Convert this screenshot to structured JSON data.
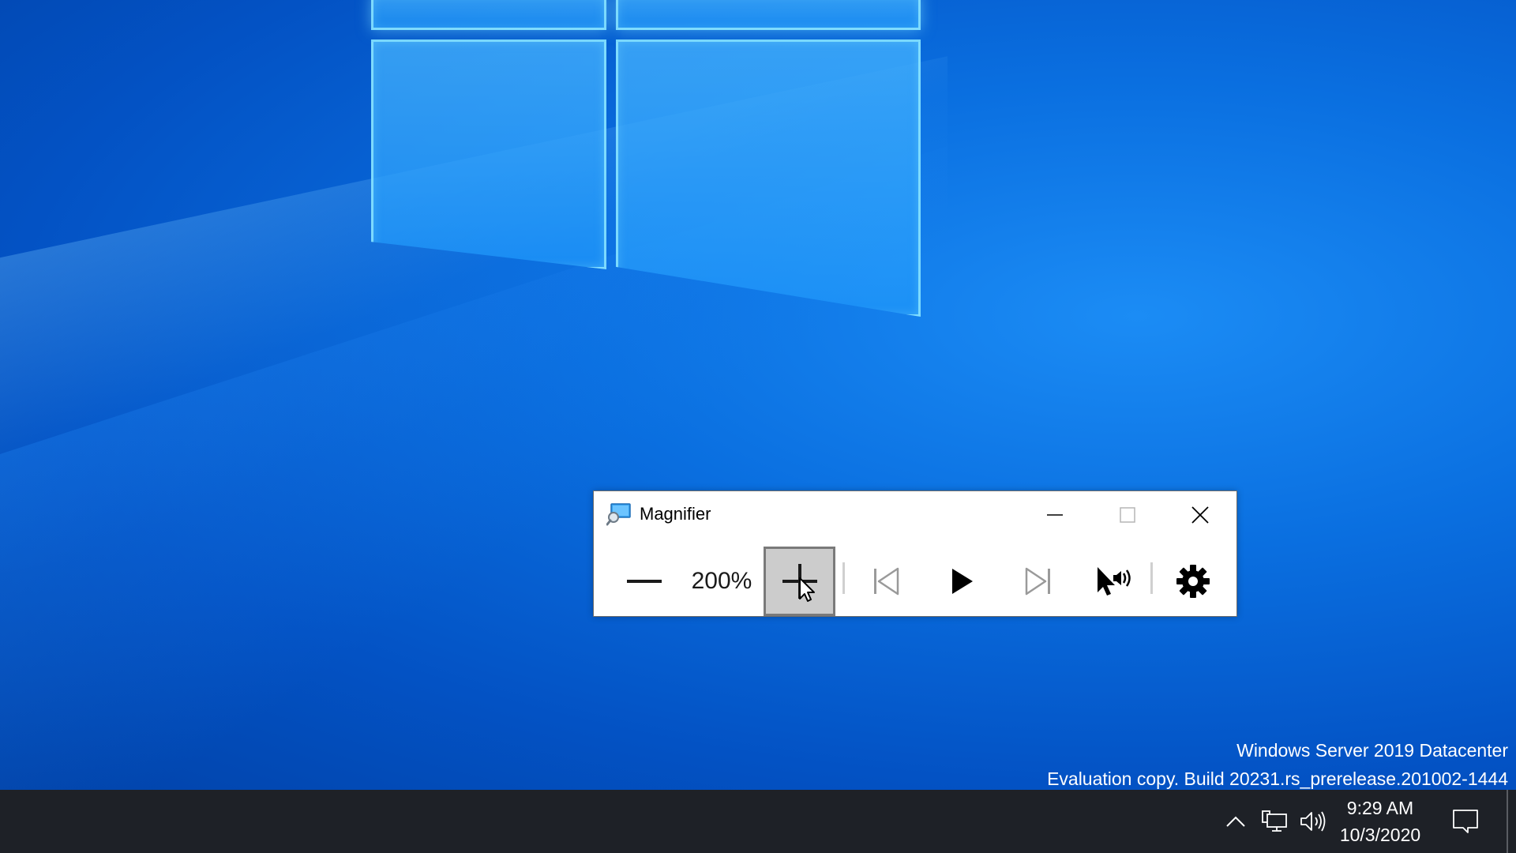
{
  "window": {
    "title": "Magnifier"
  },
  "toolbar": {
    "zoom_level": "200%"
  },
  "watermark": {
    "line1": "Windows Server 2019 Datacenter",
    "line2": "Evaluation copy. Build 20231.rs_prerelease.201002-1444"
  },
  "taskbar": {
    "clock_time": "9:29 AM",
    "clock_date": "10/3/2020"
  },
  "colors": {
    "desktop_blue": "#0a6fe0",
    "taskbar": "#1e2127",
    "zoom_in_pressed": "#cccccc"
  },
  "icons": {
    "app": "magnifier-icon",
    "minimize": "minimize-icon",
    "maximize": "maximize-icon",
    "close": "close-icon",
    "zoom_out": "minus-icon",
    "zoom_in": "plus-icon",
    "previous": "skip-previous-icon",
    "play": "play-icon",
    "next": "skip-next-icon",
    "read_from_here": "read-from-here-icon",
    "settings": "gear-icon",
    "tray_chevron": "chevron-up-icon",
    "network": "network-icon",
    "volume": "volume-icon",
    "notifications": "notification-icon"
  }
}
